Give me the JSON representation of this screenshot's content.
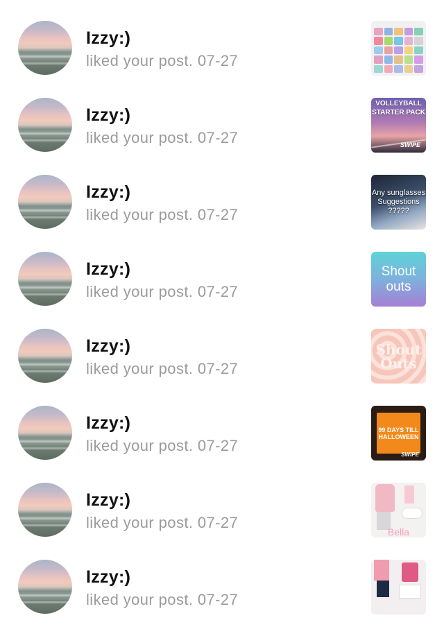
{
  "notifications": [
    {
      "name": "Izzy:)",
      "action": "liked your post.",
      "date": "07-27",
      "thumb_text": ""
    },
    {
      "name": "Izzy:)",
      "action": "liked your post.",
      "date": "07-27",
      "thumb_text": "VOLLEYBALL STARTER PACK"
    },
    {
      "name": "Izzy:)",
      "action": "liked your post.",
      "date": "07-27",
      "thumb_text": "Any sunglasses Suggestions ?????"
    },
    {
      "name": "Izzy:)",
      "action": "liked your post.",
      "date": "07-27",
      "thumb_text": "Shout outs"
    },
    {
      "name": "Izzy:)",
      "action": "liked your post.",
      "date": "07-27",
      "thumb_text": "Shout Outs"
    },
    {
      "name": "Izzy:)",
      "action": "liked your post.",
      "date": "07-27",
      "thumb_text": "99 DAYS TILL HALLOWEEN"
    },
    {
      "name": "Izzy:)",
      "action": "liked your post.",
      "date": "07-27",
      "thumb_text": "Bella"
    },
    {
      "name": "Izzy:)",
      "action": "liked your post.",
      "date": "07-27",
      "thumb_text": ""
    }
  ],
  "thumb_logo": "SWIPE",
  "colors": {
    "name": "#111111",
    "subtext": "#9b9b9b",
    "background": "#ffffff"
  }
}
